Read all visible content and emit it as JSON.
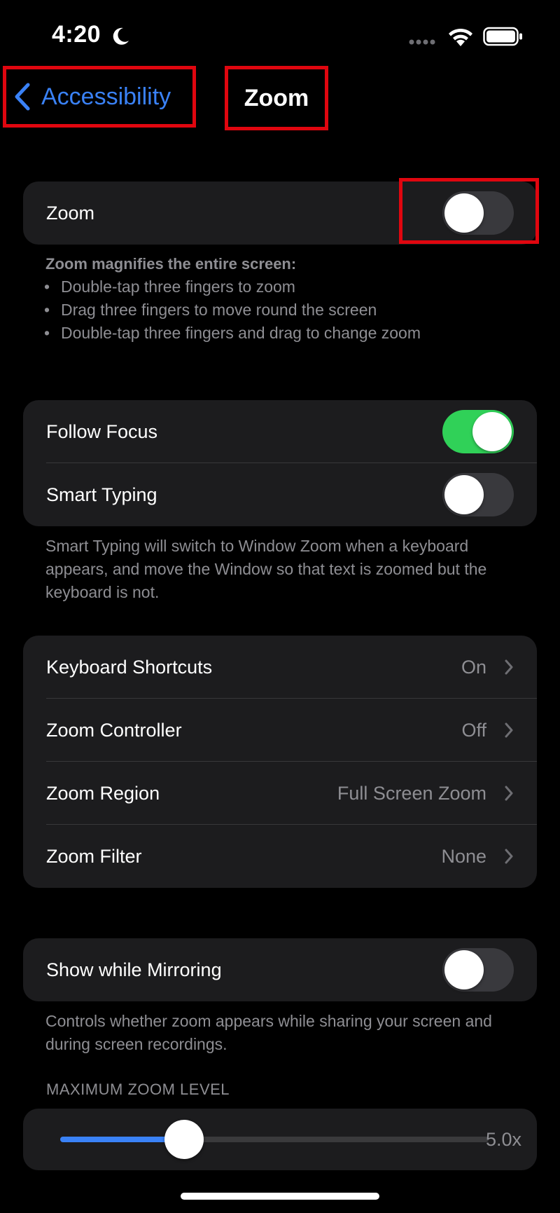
{
  "status_bar": {
    "time": "4:20",
    "icons": [
      "moon-icon",
      "cellular-dots-icon",
      "wifi-icon",
      "battery-icon"
    ]
  },
  "nav": {
    "back_label": "Accessibility",
    "title": "Zoom"
  },
  "zoom_group": {
    "label": "Zoom",
    "enabled": false
  },
  "zoom_note": {
    "title": "Zoom magnifies the entire screen:",
    "bullets": [
      "Double-tap three fingers to zoom",
      "Drag three fingers to move round the screen",
      "Double-tap three fingers and drag to change zoom"
    ]
  },
  "focus_group": {
    "follow_focus": {
      "label": "Follow Focus",
      "enabled": true
    },
    "smart_typing": {
      "label": "Smart Typing",
      "enabled": false
    }
  },
  "smart_typing_note": "Smart Typing will switch to Window Zoom when a keyboard appears, and move the Window so that text is zoomed but the keyboard is not.",
  "options_group": [
    {
      "label": "Keyboard Shortcuts",
      "value": "On"
    },
    {
      "label": "Zoom Controller",
      "value": "Off"
    },
    {
      "label": "Zoom Region",
      "value": "Full Screen Zoom"
    },
    {
      "label": "Zoom Filter",
      "value": "None"
    }
  ],
  "mirroring_group": {
    "label": "Show while Mirroring",
    "enabled": false
  },
  "mirroring_note": "Controls whether zoom appears while sharing your screen and during screen recordings.",
  "max_zoom": {
    "header": "MAXIMUM ZOOM LEVEL",
    "value_label": "5.0x",
    "fraction": 0.29
  },
  "colors": {
    "accent": "#3a82f7",
    "toggle_on": "#30d158",
    "highlight": "#e0060f",
    "group_bg": "#1c1c1e"
  }
}
